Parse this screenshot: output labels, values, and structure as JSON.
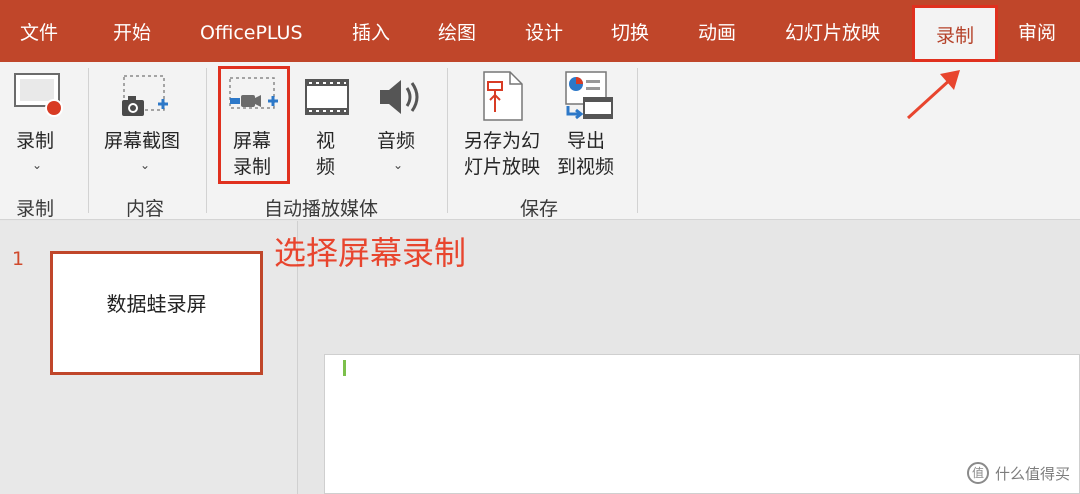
{
  "tabs": [
    "文件",
    "开始",
    "OfficePLUS",
    "插入",
    "绘图",
    "设计",
    "切换",
    "动画",
    "幻灯片放映",
    "录制",
    "审阅"
  ],
  "active_tab": "录制",
  "ribbon": {
    "record_group": {
      "button": "录制",
      "label": "录制"
    },
    "content_group": {
      "button": "屏幕截图",
      "label": "内容"
    },
    "media_group": {
      "screen_record_line1": "屏幕",
      "screen_record_line2": "录制",
      "video_line1": "视",
      "video_line2": "频",
      "audio": "音频",
      "label": "自动播放媒体"
    },
    "save_group": {
      "save_as_line1": "另存为幻",
      "save_as_line2": "灯片放映",
      "export_line1": "导出",
      "export_line2": "到视频",
      "label": "保存"
    }
  },
  "annotation": "选择屏幕录制",
  "slides": [
    {
      "number": "1",
      "text": "数据蛙录屏"
    }
  ],
  "watermark": "什么值得买",
  "colors": {
    "accent": "#c0462a",
    "highlight": "#e0301e",
    "annotation": "#e8452e"
  }
}
